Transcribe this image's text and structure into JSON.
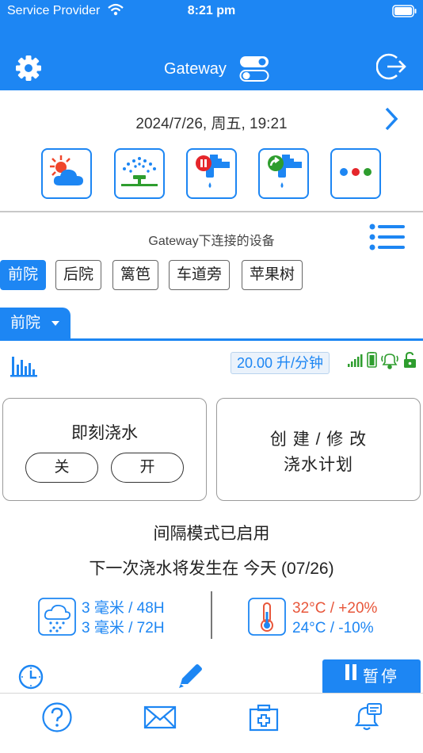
{
  "status_bar": {
    "carrier": "Service Provider",
    "time": "8:21 pm"
  },
  "header": {
    "title": "Gateway",
    "icons": [
      "gear-icon",
      "toggle-icon",
      "logout-icon"
    ]
  },
  "date_row": {
    "text": "2024/7/26, 周五, 19:21"
  },
  "quick_actions": [
    "weather-icon",
    "sprinkler-icon",
    "faucet-pause-icon",
    "faucet-resume-icon",
    "more-icon"
  ],
  "devices": {
    "title": "Gateway下连接的设备",
    "chips": [
      {
        "label": "前院",
        "active": true
      },
      {
        "label": "后院",
        "active": false
      },
      {
        "label": "篱笆",
        "active": false
      },
      {
        "label": "车道旁",
        "active": false
      },
      {
        "label": "苹果树",
        "active": false
      }
    ]
  },
  "zone_tab": {
    "label": "前院"
  },
  "flow": {
    "text": "20.00 升/分钟"
  },
  "watering_now": {
    "title": "即刻浇水",
    "off_label": "关",
    "on_label": "开"
  },
  "schedule": {
    "line1": "创 建 / 修 改",
    "line2": "浇水计划"
  },
  "mode": {
    "text": "间隔模式已启用"
  },
  "next_watering": {
    "text": "下一次浇水将发生在 今天 (07/26)"
  },
  "rain": {
    "line1": "3 毫米 / 48H",
    "line2": "3 毫米 / 72H"
  },
  "temperature": {
    "line1": "32°C / +20%",
    "line2": "24°C / -10%"
  },
  "pause_button": {
    "label": "暂停"
  },
  "colors": {
    "primary": "#1d86f3",
    "hot": "#e8563a",
    "green": "#2e9d2e"
  },
  "tabbar": [
    "help-icon",
    "mail-icon",
    "first-aid-icon",
    "alarm-icon"
  ]
}
